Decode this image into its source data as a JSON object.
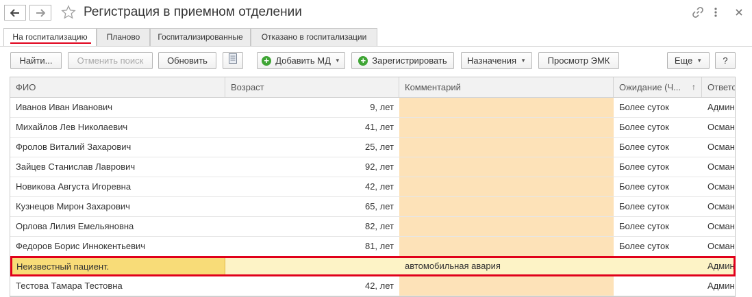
{
  "window": {
    "title": "Регистрация в приемном отделении"
  },
  "tabs": [
    {
      "label": "На госпитализацию",
      "active": true
    },
    {
      "label": "Планово",
      "active": false
    },
    {
      "label": "Госпитализированные",
      "active": false
    },
    {
      "label": "Отказано в госпитализации",
      "active": false
    }
  ],
  "toolbar": {
    "find": "Найти...",
    "cancel_search": "Отменить поиск",
    "refresh": "Обновить",
    "add_md": "Добавить МД",
    "register": "Зарегистрировать",
    "appointments": "Назначения",
    "view_emk": "Просмотр ЭМК",
    "more": "Еще",
    "help": "?"
  },
  "colors": {
    "accent_red": "#e0001b",
    "comment_bg": "#fde2b8",
    "selected_row_bg": "#fdf3c6",
    "selected_cell_bg": "#f8dc78",
    "add_icon_green": "#3fa535"
  },
  "icons": [
    "back-arrow-icon",
    "forward-arrow-icon",
    "star-icon",
    "link-icon",
    "more-vertical-icon",
    "close-icon",
    "list-icon",
    "add-icon",
    "sort-asc-icon"
  ],
  "grid": {
    "columns": [
      "ФИО",
      "Возраст",
      "Комментарий",
      "Ожидание (Ч...",
      "Ответс"
    ],
    "rows": [
      {
        "fio": "Иванов Иван Иванович",
        "age": "9, лет",
        "comment": "",
        "wait": "Более суток",
        "resp": "Админ"
      },
      {
        "fio": "Михайлов Лев Николаевич",
        "age": "41, лет",
        "comment": "",
        "wait": "Более суток",
        "resp": "Осман"
      },
      {
        "fio": "Фролов Виталий Захарович",
        "age": "25, лет",
        "comment": "",
        "wait": "Более суток",
        "resp": "Осман"
      },
      {
        "fio": "Зайцев Станислав Лаврович",
        "age": "92, лет",
        "comment": "",
        "wait": "Более суток",
        "resp": "Осман"
      },
      {
        "fio": "Новикова Августа Игоревна",
        "age": "42, лет",
        "comment": "",
        "wait": "Более суток",
        "resp": "Осман"
      },
      {
        "fio": "Кузнецов Мирон Захарович",
        "age": "65, лет",
        "comment": "",
        "wait": "Более суток",
        "resp": "Осман"
      },
      {
        "fio": "Орлова Лилия Емельяновна",
        "age": "82, лет",
        "comment": "",
        "wait": "Более суток",
        "resp": "Осман"
      },
      {
        "fio": "Федоров Борис Иннокентьевич",
        "age": "81, лет",
        "comment": "",
        "wait": "Более суток",
        "resp": "Осман"
      },
      {
        "fio": "Неизвестный пациент.",
        "age": "",
        "comment": "автомобильная авария",
        "wait": "",
        "resp": "Админ",
        "selected": true
      },
      {
        "fio": "Тестова Тамара Тестовна",
        "age": "42, лет",
        "comment": "",
        "wait": "",
        "resp": "Админ"
      }
    ]
  }
}
